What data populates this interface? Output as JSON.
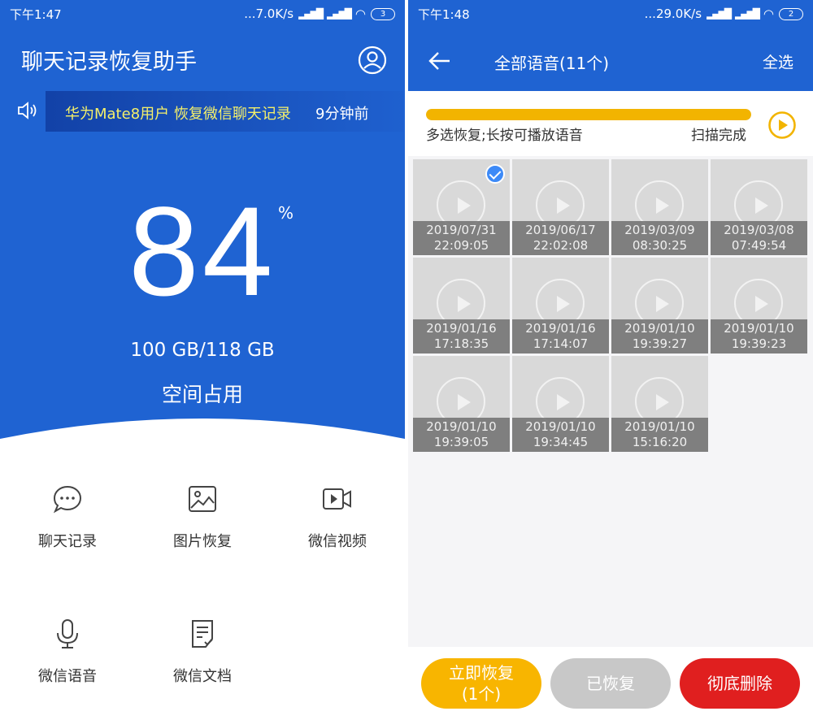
{
  "left": {
    "status": {
      "time": "下午1:47",
      "speed": "...7.0K/s",
      "battery": "3"
    },
    "title": "聊天记录恢复助手",
    "notice": {
      "text": "华为Mate8用户 恢复微信聊天记录",
      "time": "9分钟前"
    },
    "usage": {
      "percent": "84",
      "percent_sign": "%",
      "storage": "100 GB/118 GB",
      "label": "空间占用"
    },
    "features": [
      {
        "label": "聊天记录",
        "icon": "chat-bubble-icon"
      },
      {
        "label": "图片恢复",
        "icon": "image-icon"
      },
      {
        "label": "微信视频",
        "icon": "video-icon"
      },
      {
        "label": "微信语音",
        "icon": "microphone-icon"
      },
      {
        "label": "微信文档",
        "icon": "document-icon"
      }
    ]
  },
  "right": {
    "status": {
      "time": "下午1:48",
      "speed": "...29.0K/s",
      "battery": "2"
    },
    "header": {
      "title": "全部语音(11个)",
      "select_all": "全选"
    },
    "scan": {
      "hint": "多选恢复;长按可播放语音",
      "status": "扫描完成",
      "progress": 1.0
    },
    "voice_items": [
      {
        "date": "2019/07/31",
        "time": "22:09:05",
        "selected": true
      },
      {
        "date": "2019/06/17",
        "time": "22:02:08",
        "selected": false
      },
      {
        "date": "2019/03/09",
        "time": "08:30:25",
        "selected": false
      },
      {
        "date": "2019/03/08",
        "time": "07:49:54",
        "selected": false
      },
      {
        "date": "2019/01/16",
        "time": "17:18:35",
        "selected": false
      },
      {
        "date": "2019/01/16",
        "time": "17:14:07",
        "selected": false
      },
      {
        "date": "2019/01/10",
        "time": "19:39:27",
        "selected": false
      },
      {
        "date": "2019/01/10",
        "time": "19:39:23",
        "selected": false
      },
      {
        "date": "2019/01/10",
        "time": "19:39:05",
        "selected": false
      },
      {
        "date": "2019/01/10",
        "time": "19:34:45",
        "selected": false
      },
      {
        "date": "2019/01/10",
        "time": "15:16:20",
        "selected": false
      }
    ],
    "buttons": {
      "recover_line1": "立即恢复",
      "recover_line2": "(1个)",
      "recovered": "已恢复",
      "delete": "彻底删除"
    }
  },
  "colors": {
    "primary": "#1f63d2",
    "accent_yellow": "#f8b500",
    "notice_text": "#f5f06a",
    "delete_red": "#e01f1f",
    "disabled_gray": "#c8c8c8"
  }
}
